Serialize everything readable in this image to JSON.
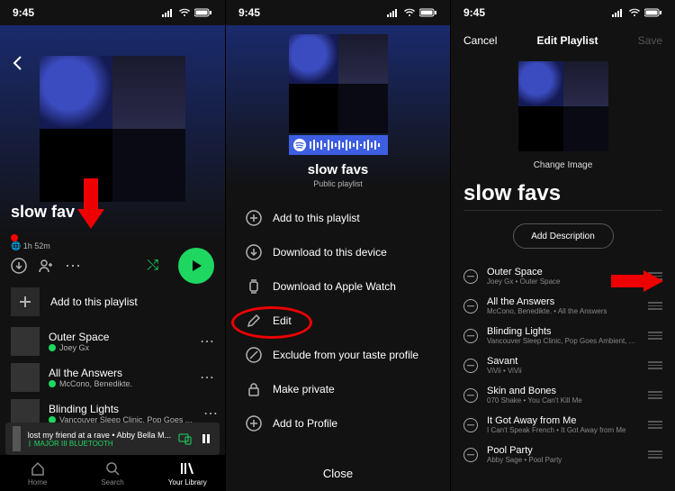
{
  "status": {
    "time": "9:45"
  },
  "s1": {
    "title": "slow fav",
    "duration": "1h 52m",
    "actions": {
      "download": "download-icon",
      "adduser": "add-user-icon",
      "more": "⋯"
    },
    "add_label": "Add to this playlist",
    "tracks": [
      {
        "name": "Outer Space",
        "sub": "Joey Gx"
      },
      {
        "name": "All the Answers",
        "sub": "McCono, Benedikte."
      },
      {
        "name": "Blinding Lights",
        "sub": "Vancouver Sleep Clinic, Pop Goes Ambient, ..."
      }
    ],
    "nowplaying": {
      "title": "lost my friend at a rave • Abby Bella M...",
      "sub": "MAJOR III BLUETOOTH"
    },
    "tabs": [
      {
        "label": "Home"
      },
      {
        "label": "Search"
      },
      {
        "label": "Your Library"
      }
    ]
  },
  "s2": {
    "title": "slow favs",
    "subtitle": "Public playlist",
    "items": [
      {
        "icon": "plus-circle-icon",
        "label": "Add to this playlist"
      },
      {
        "icon": "download-icon",
        "label": "Download to this device"
      },
      {
        "icon": "watch-icon",
        "label": "Download to Apple Watch"
      },
      {
        "icon": "pencil-icon",
        "label": "Edit"
      },
      {
        "icon": "exclude-icon",
        "label": "Exclude from your taste profile"
      },
      {
        "icon": "lock-icon",
        "label": "Make private"
      },
      {
        "icon": "profile-plus-icon",
        "label": "Add to Profile"
      }
    ],
    "close": "Close"
  },
  "s3": {
    "cancel": "Cancel",
    "title": "Edit Playlist",
    "save": "Save",
    "change": "Change Image",
    "pl_title": "slow favs",
    "add_desc": "Add Description",
    "tracks": [
      {
        "name": "Outer Space",
        "sub": "Joey Gx • Outer Space"
      },
      {
        "name": "All the Answers",
        "sub": "McCono, Benedikte. • All the Answers"
      },
      {
        "name": "Blinding Lights",
        "sub": "Vancouver Sleep Clinic, Pop Goes Ambient, Am..."
      },
      {
        "name": "Savant",
        "sub": "ViVii • ViVii"
      },
      {
        "name": "Skin and Bones",
        "sub": "070 Shake • You Can't Kill Me"
      },
      {
        "name": "It Got Away from Me",
        "sub": "I Can't Speak French • It Got Away from Me"
      },
      {
        "name": "Pool Party",
        "sub": "Abby Sage • Pool Party"
      }
    ]
  }
}
